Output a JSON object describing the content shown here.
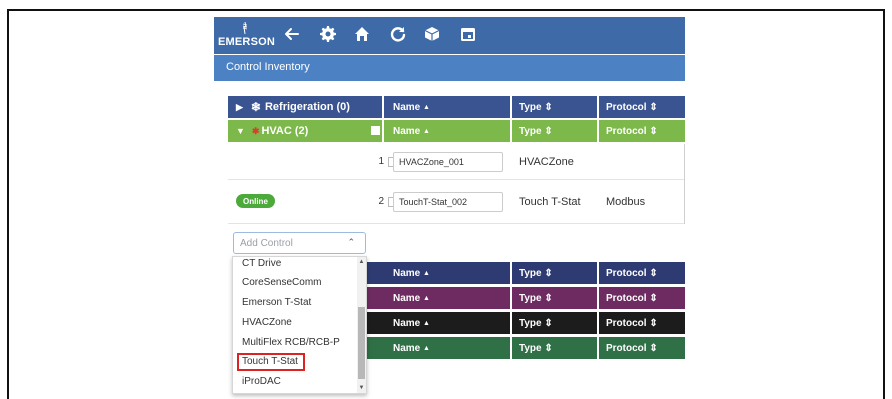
{
  "app": {
    "brand": "EMERSON",
    "section_title": "Control Inventory"
  },
  "toolbar": {
    "icons": [
      "arrow-left-icon",
      "gear-icon",
      "home-icon",
      "refresh-icon",
      "box-icon",
      "calendar-icon"
    ]
  },
  "columns": {
    "name": "Name",
    "type": "Type",
    "protocol": "Protocol",
    "name_sort": "⌃",
    "sort": "⇕"
  },
  "groups": {
    "refrigeration": {
      "label": "Refrigeration (0)",
      "color": "#3a5391"
    },
    "hvac": {
      "label": "HVAC (2)",
      "color": "#7cb84a"
    },
    "group3_color": "#2e3b72",
    "group4_color": "#6e2b61",
    "group5_color": "#1c1c1c",
    "group6_color": "#2f7046"
  },
  "rows": [
    {
      "num": "1",
      "name": "HVACZone_001",
      "type": "HVACZone",
      "protocol": "",
      "status": ""
    },
    {
      "num": "2",
      "name": "TouchT-Stat_002",
      "type": "Touch T-Stat",
      "protocol": "Modbus",
      "status": "Online"
    }
  ],
  "add_control": {
    "placeholder": "Add Control",
    "options": [
      "CT Drive",
      "CoreSenseComm",
      "Emerson T-Stat",
      "HVACZone",
      "MultiFlex RCB/RCB-P",
      "Touch T-Stat",
      "iProDAC"
    ],
    "highlighted": "Touch T-Stat"
  }
}
